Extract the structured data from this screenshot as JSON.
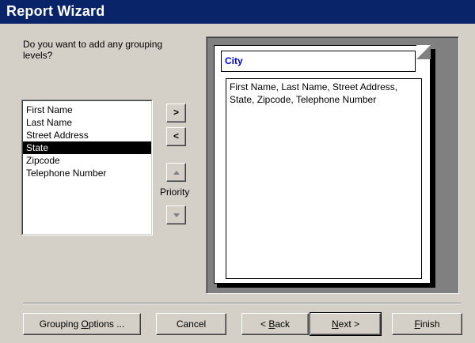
{
  "window": {
    "title": "Report Wizard"
  },
  "prompt": "Do you want to add any grouping levels?",
  "fields": {
    "items": [
      "First Name",
      "Last Name",
      "Street Address",
      "State",
      "Zipcode",
      "Telephone Number"
    ],
    "selected_index": 3
  },
  "controls": {
    "add_label": ">",
    "remove_label": "<",
    "priority_label": "Priority",
    "up_icon": "up-arrow-icon",
    "down_icon": "down-arrow-icon"
  },
  "preview": {
    "group_label": "City",
    "detail_text": "First Name, Last Name, Street Address, State, Zipcode, Telephone Number"
  },
  "buttons": {
    "grouping_options": {
      "before": "Grouping ",
      "u": "O",
      "after": "ptions ..."
    },
    "cancel": "Cancel",
    "back": {
      "before": "< ",
      "u": "B",
      "after": "ack"
    },
    "next": {
      "before": "",
      "u": "N",
      "after": "ext >"
    },
    "finish": {
      "before": "",
      "u": "F",
      "after": "inish"
    }
  }
}
